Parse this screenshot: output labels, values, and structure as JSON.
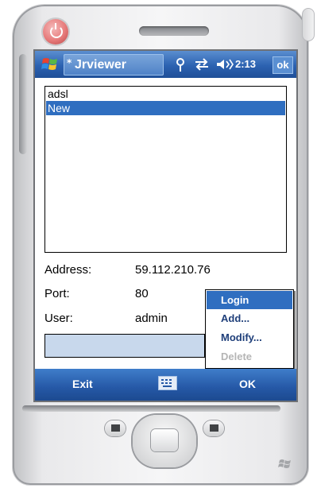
{
  "titlebar": {
    "app_title": "Jrviewer",
    "title_marker": "*",
    "time": "2:13",
    "ok_label": "ok",
    "icons": [
      "windows-start-icon",
      "antenna-icon",
      "sync-icon",
      "speaker-icon"
    ]
  },
  "list": {
    "items": [
      "adsl",
      "New"
    ],
    "selected_index": 1
  },
  "fields": {
    "address_label": "Address:",
    "address_value": "59.112.210.76",
    "port_label": "Port:",
    "port_value": "80",
    "user_label": "User:",
    "user_value": "admin"
  },
  "menu": {
    "items": [
      "Login",
      "Add...",
      "Modify...",
      "Delete"
    ],
    "active_index": 0,
    "disabled_index": 3
  },
  "softbar": {
    "left": "Exit",
    "right": "OK",
    "center_icon": "keyboard-icon"
  },
  "colors": {
    "titlebar": "#2c62b1",
    "selection": "#2f6ec0",
    "softbar": "#2558a6"
  }
}
